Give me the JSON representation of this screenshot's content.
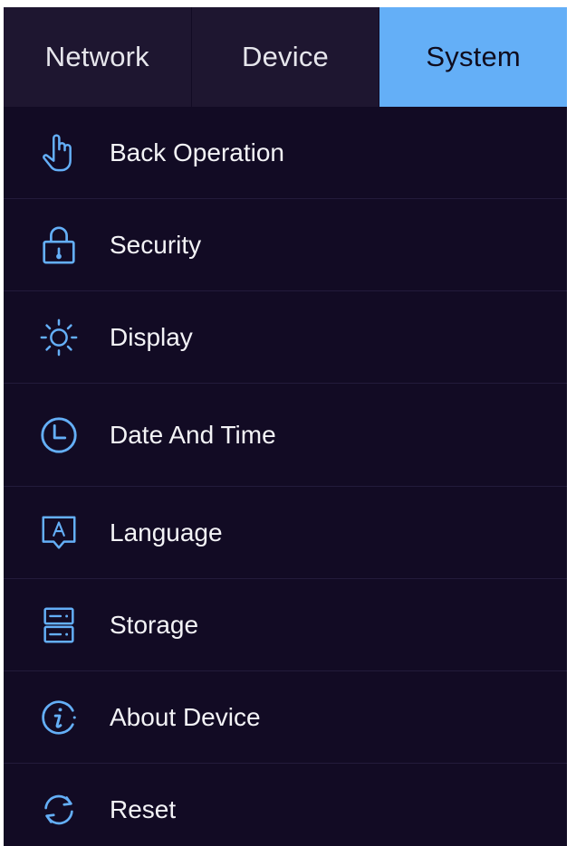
{
  "tabs": [
    {
      "label": "Network",
      "active": false
    },
    {
      "label": "Device",
      "active": false
    },
    {
      "label": "System",
      "active": true
    }
  ],
  "menu": {
    "items": [
      {
        "label": "Back Operation",
        "icon": "hand-pointer-icon"
      },
      {
        "label": "Security",
        "icon": "lock-icon"
      },
      {
        "label": "Display",
        "icon": "brightness-icon"
      },
      {
        "label": "Date And Time",
        "icon": "clock-icon"
      },
      {
        "label": "Language",
        "icon": "language-icon"
      },
      {
        "label": "Storage",
        "icon": "storage-icon"
      },
      {
        "label": "About Device",
        "icon": "info-icon"
      },
      {
        "label": "Reset",
        "icon": "reset-icon"
      }
    ]
  },
  "colors": {
    "background": "#120b24",
    "tab_bar": "#1e1630",
    "accent": "#64aff7",
    "text": "#f3f3f6"
  }
}
